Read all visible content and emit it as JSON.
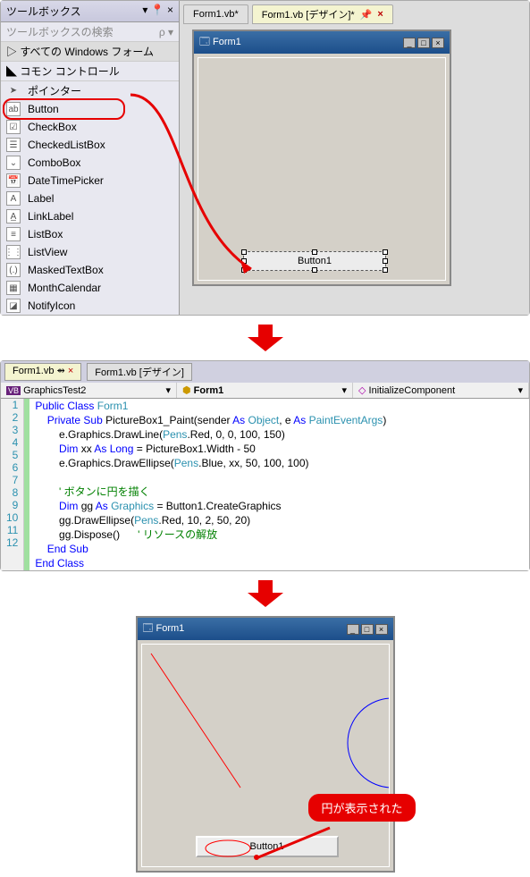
{
  "toolbox": {
    "title": "ツールボックス",
    "search_placeholder": "ツールボックスの検索",
    "group_winforms": "すべての Windows フォーム",
    "group_common": "コモン コントロール",
    "items": [
      {
        "icon": "pointer",
        "label": "ポインター"
      },
      {
        "icon": "ab",
        "label": "Button"
      },
      {
        "icon": "check",
        "label": "CheckBox"
      },
      {
        "icon": "list",
        "label": "CheckedListBox"
      },
      {
        "icon": "combo",
        "label": "ComboBox"
      },
      {
        "icon": "date",
        "label": "DateTimePicker"
      },
      {
        "icon": "A",
        "label": "Label"
      },
      {
        "icon": "Au",
        "label": "LinkLabel"
      },
      {
        "icon": "lb",
        "label": "ListBox"
      },
      {
        "icon": "lv",
        "label": "ListView"
      },
      {
        "icon": "mask",
        "label": "MaskedTextBox"
      },
      {
        "icon": "cal",
        "label": "MonthCalendar"
      },
      {
        "icon": "tray",
        "label": "NotifyIcon"
      }
    ]
  },
  "tabs": {
    "code": "Form1.vb*",
    "design": "Form1.vb [デザイン]*"
  },
  "form": {
    "title": "Form1",
    "button_text": "Button1"
  },
  "code_tabs": {
    "code": "Form1.vb",
    "design": "Form1.vb [デザイン]",
    "pin": "⇴"
  },
  "dropdowns": {
    "project": "GraphicsTest2",
    "object": "Form1",
    "method": "InitializeComponent"
  },
  "code": {
    "lines": [
      {
        "n": 1,
        "html": "<span class='kw'>Public Class</span> <span class='type'>Form1</span>"
      },
      {
        "n": 2,
        "html": "    <span class='kw'>Private Sub</span> PictureBox1_Paint(sender <span class='kw'>As</span> <span class='type'>Object</span>, e <span class='kw'>As</span> <span class='type'>PaintEventArgs</span>)"
      },
      {
        "n": 3,
        "html": "        e.Graphics.DrawLine(<span class='type'>Pens</span>.Red, 0, 0, 100, 150)"
      },
      {
        "n": 4,
        "html": "        <span class='kw'>Dim</span> xx <span class='kw'>As Long</span> = PictureBox1.Width - 50"
      },
      {
        "n": 5,
        "html": "        e.Graphics.DrawEllipse(<span class='type'>Pens</span>.Blue, xx, 50, 100, 100)"
      },
      {
        "n": 6,
        "html": ""
      },
      {
        "n": 7,
        "html": "        <span class='cmt'>' ボタンに円を描く</span>"
      },
      {
        "n": 8,
        "html": "        <span class='kw'>Dim</span> gg <span class='kw'>As</span> <span class='type'>Graphics</span> = Button1.CreateGraphics"
      },
      {
        "n": 9,
        "html": "        gg.DrawEllipse(<span class='type'>Pens</span>.Red, 10, 2, 50, 20)"
      },
      {
        "n": 10,
        "html": "        gg.Dispose()      <span class='cmt'>' リソースの解放</span>"
      },
      {
        "n": 11,
        "html": "    <span class='kw'>End Sub</span>"
      },
      {
        "n": 12,
        "html": "<span class='kw'>End Class</span>"
      }
    ]
  },
  "callout": "円が表示された",
  "icons": {
    "search": "🔍",
    "triangle_right": "▷",
    "triangle_down": "◢",
    "dropdown_arrow": "▾",
    "ddarrow": "▼",
    "pin": "📌",
    "close": "×",
    "min": "_",
    "max": "□",
    "formicon": "🗔",
    "wrench": "🔧",
    "lightning": "⚡",
    "vb": "VB"
  }
}
